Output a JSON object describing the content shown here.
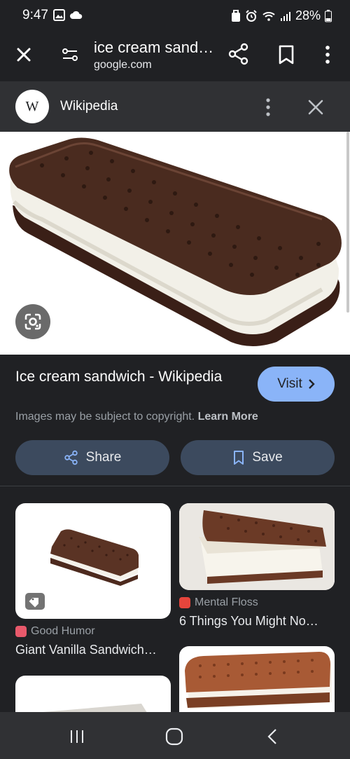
{
  "status_bar": {
    "time": "9:47",
    "battery": "28%"
  },
  "toolbar": {
    "title": "ice cream sand…",
    "domain": "google.com"
  },
  "source": {
    "logo_letter": "W",
    "name": "Wikipedia"
  },
  "result": {
    "title": "Ice cream sandwich - Wikipedia",
    "visit_label": "Visit",
    "copyright_text": "Images may be subject to copyright.",
    "learn_more": "Learn More",
    "share_label": "Share",
    "save_label": "Save"
  },
  "related": [
    {
      "source": "Good Humor",
      "title": "Giant Vanilla Sandwich…",
      "favicon_color": "#e8596b"
    },
    {
      "source": "Mental Floss",
      "title": "6 Things You Might No…",
      "favicon_color": "#e6453c"
    }
  ],
  "colors": {
    "accent": "#8ab4f8",
    "action_button": "#3c4a5e",
    "background": "#202124"
  }
}
